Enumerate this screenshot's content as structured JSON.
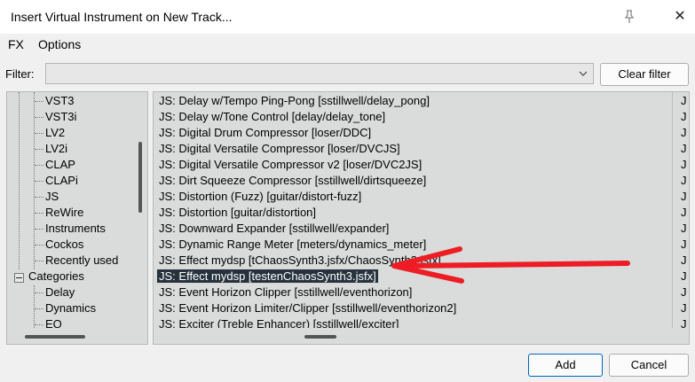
{
  "window": {
    "title": "Insert Virtual Instrument on New Track...",
    "close_label": "✕"
  },
  "menu": [
    "FX",
    "Options"
  ],
  "filter": {
    "label": "Filter:",
    "value": "",
    "clear_label": "Clear filter"
  },
  "tree": {
    "items": [
      "VST3",
      "VST3i",
      "LV2",
      "LV2i",
      "CLAP",
      "CLAPi",
      "JS",
      "ReWire",
      "Instruments",
      "Cockos",
      "Recently used"
    ],
    "categories_label": "Categories",
    "category_items": [
      "Delay",
      "Dynamics",
      "EQ"
    ]
  },
  "list": {
    "rows": [
      "JS: Delay w/Tempo Ping-Pong [sstillwell/delay_pong]",
      "JS: Delay w/Tone Control [delay/delay_tone]",
      "JS: Digital Drum Compressor [loser/DDC]",
      "JS: Digital Versatile Compressor [loser/DVCJS]",
      "JS: Digital Versatile Compressor v2 [loser/DVC2JS]",
      "JS: Dirt Squeeze Compressor [sstillwell/dirtsqueeze]",
      "JS: Distortion (Fuzz) [guitar/distort-fuzz]",
      "JS: Distortion [guitar/distortion]",
      "JS: Downward Expander [sstillwell/expander]",
      "JS: Dynamic Range Meter [meters/dynamics_meter]",
      "JS: Effect mydsp [tChaosSynth3.jsfx/ChaosSynth3.jsfx]",
      "JS: Effect mydsp [testenChaosSynth3.jsfx]",
      "JS: Event Horizon Clipper [sstillwell/eventhorizon]",
      "JS: Event Horizon Limiter/Clipper [sstillwell/eventhorizon2]",
      "JS: Exciter (Treble Enhancer) [sstillwell/exciter]"
    ],
    "type_col": "J",
    "selected_index": 11
  },
  "buttons": {
    "add": "Add",
    "cancel": "Cancel"
  },
  "colors": {
    "selection": "#26333d",
    "annotation_arrow": "#ee1c24",
    "panel_bg": "#d9dcda"
  }
}
